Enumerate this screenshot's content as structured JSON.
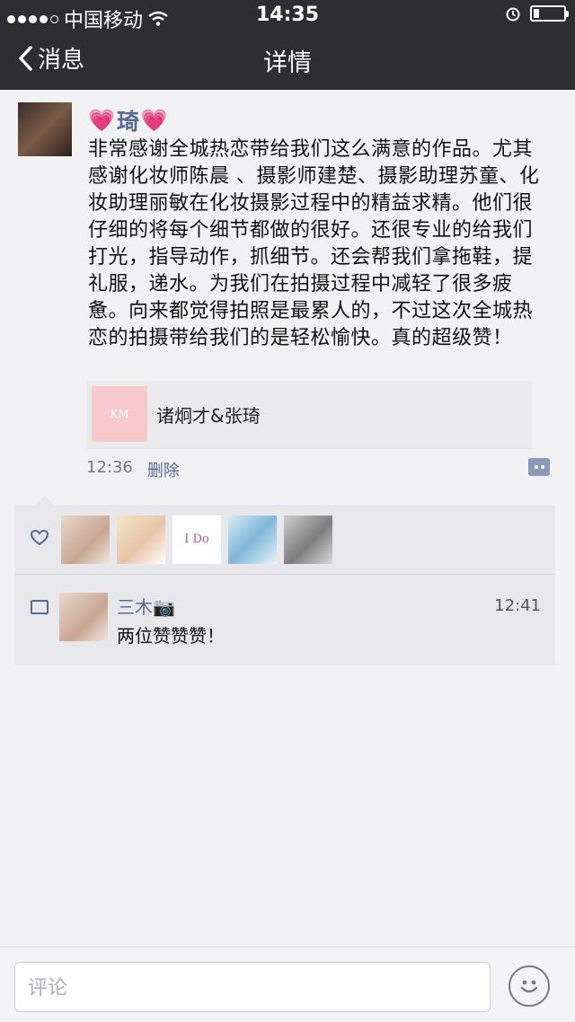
{
  "statusbar": {
    "carrier": "中国移动",
    "time": "14:35",
    "battery_level": 0.2
  },
  "nav": {
    "back_label": "消息",
    "title": "详情"
  },
  "post": {
    "author": "琦",
    "text": "非常感谢全城热恋带给我们这么满意的作品。尤其感谢化妆师陈晨 、摄影师建楚、摄影助理苏童、化妆助理丽敏在化妆摄影过程中的精益求精。他们很仔细的将每个细节都做的很好。还很专业的给我们打光，指导动作，抓细节。还会帮我们拿拖鞋，提礼服，递水。为我们在拍摄过程中减轻了很多疲惫。向来都觉得拍照是最累人的，不过这次全城热恋的拍摄带给我们的是轻松愉快。真的超级赞！",
    "share_title": "诸炯才&张琦",
    "time": "12:36",
    "delete_label": "删除"
  },
  "likes": {
    "avatars": [
      "avatar-1",
      "avatar-2",
      "avatar-3",
      "avatar-4",
      "avatar-5"
    ]
  },
  "comment": {
    "name": "三木📷",
    "time": "12:41",
    "text": "两位赞赞赞！"
  },
  "input": {
    "placeholder": "评论"
  }
}
